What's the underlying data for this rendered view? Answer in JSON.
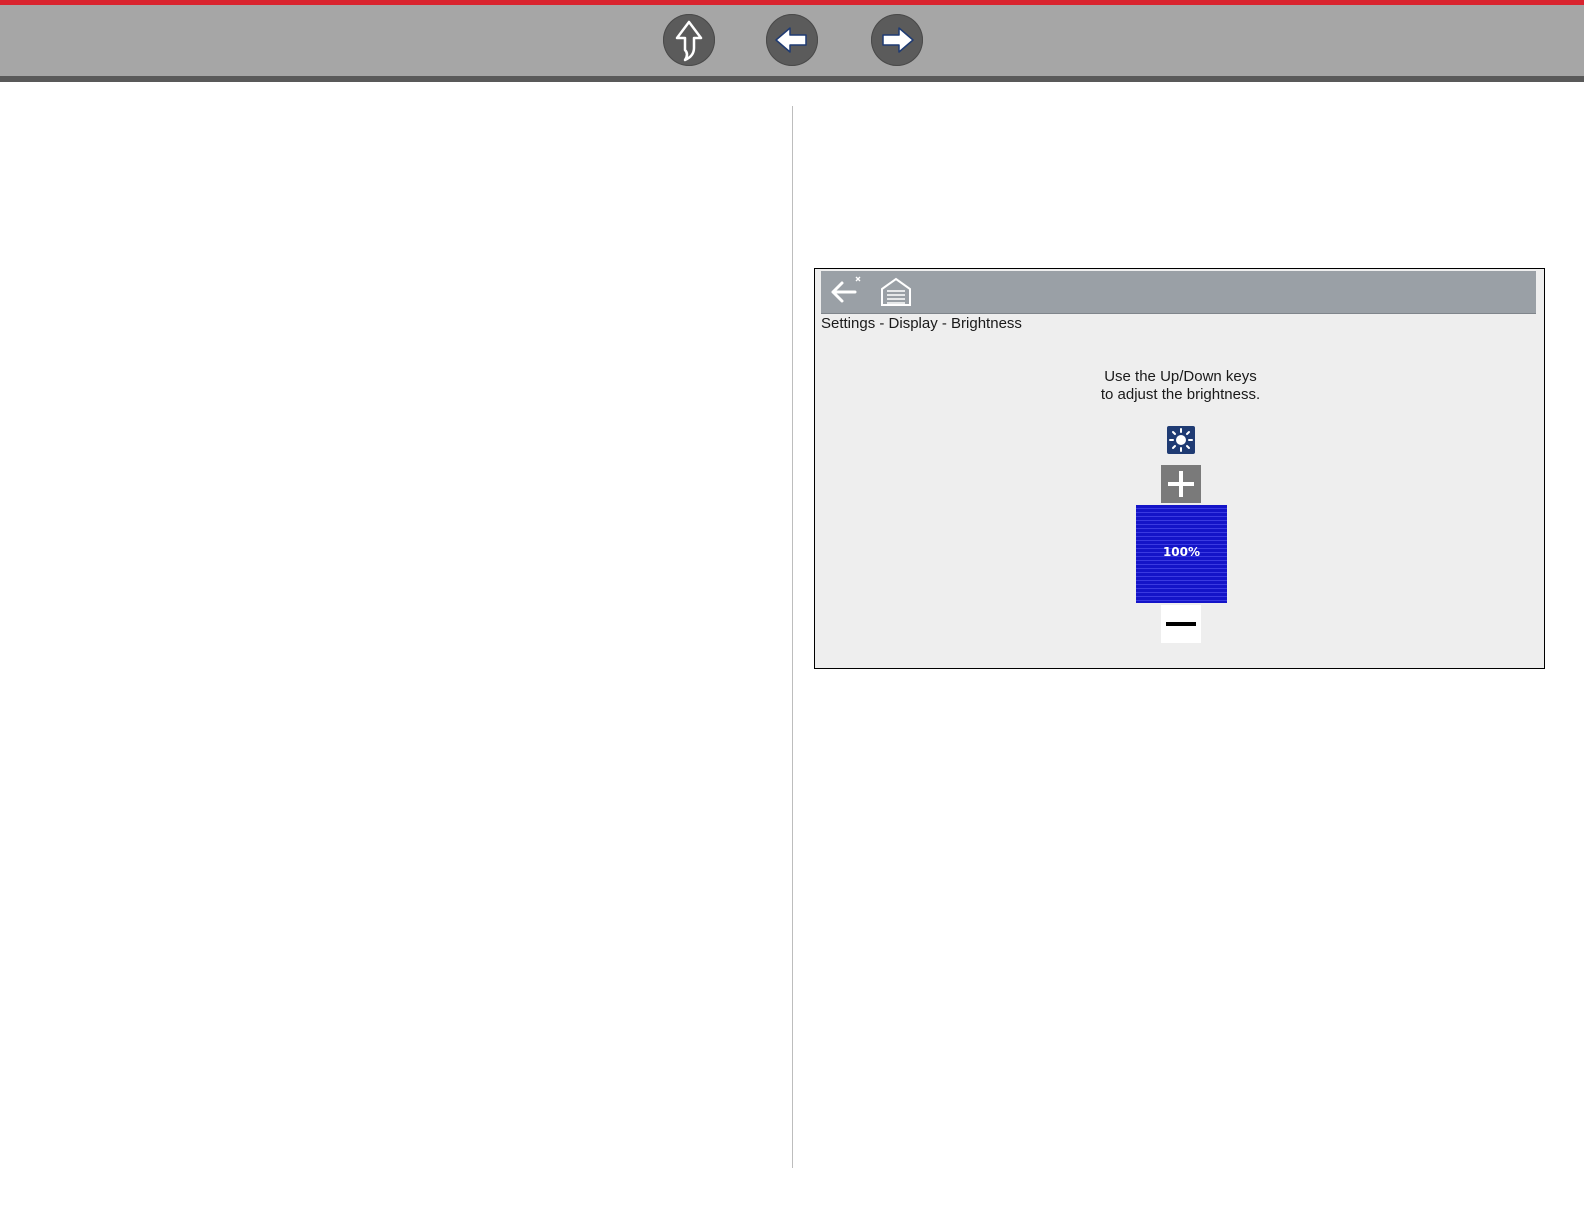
{
  "nav": {
    "buttons": [
      {
        "name": "up-button",
        "icon": "up-arrow-icon"
      },
      {
        "name": "previous-button",
        "icon": "left-arrow-icon"
      },
      {
        "name": "next-button",
        "icon": "right-arrow-icon"
      }
    ],
    "colors": {
      "bar": "#a6a6a6",
      "accent_line": "#d9232e",
      "button": "#5b5b5b"
    }
  },
  "screen": {
    "toolbar": {
      "back_icon": "back-arrow-icon",
      "home_icon": "home-icon"
    },
    "breadcrumb": "Settings - Display - Brightness",
    "instructions": {
      "line1": "Use the Up/Down keys",
      "line2": "to adjust the brightness."
    },
    "brightness": {
      "icon": "sun-icon",
      "increase_icon": "plus-icon",
      "decrease_icon": "minus-icon",
      "level_label": "100%",
      "level_fraction": 1.0,
      "bar_color": "#1414c8"
    }
  }
}
